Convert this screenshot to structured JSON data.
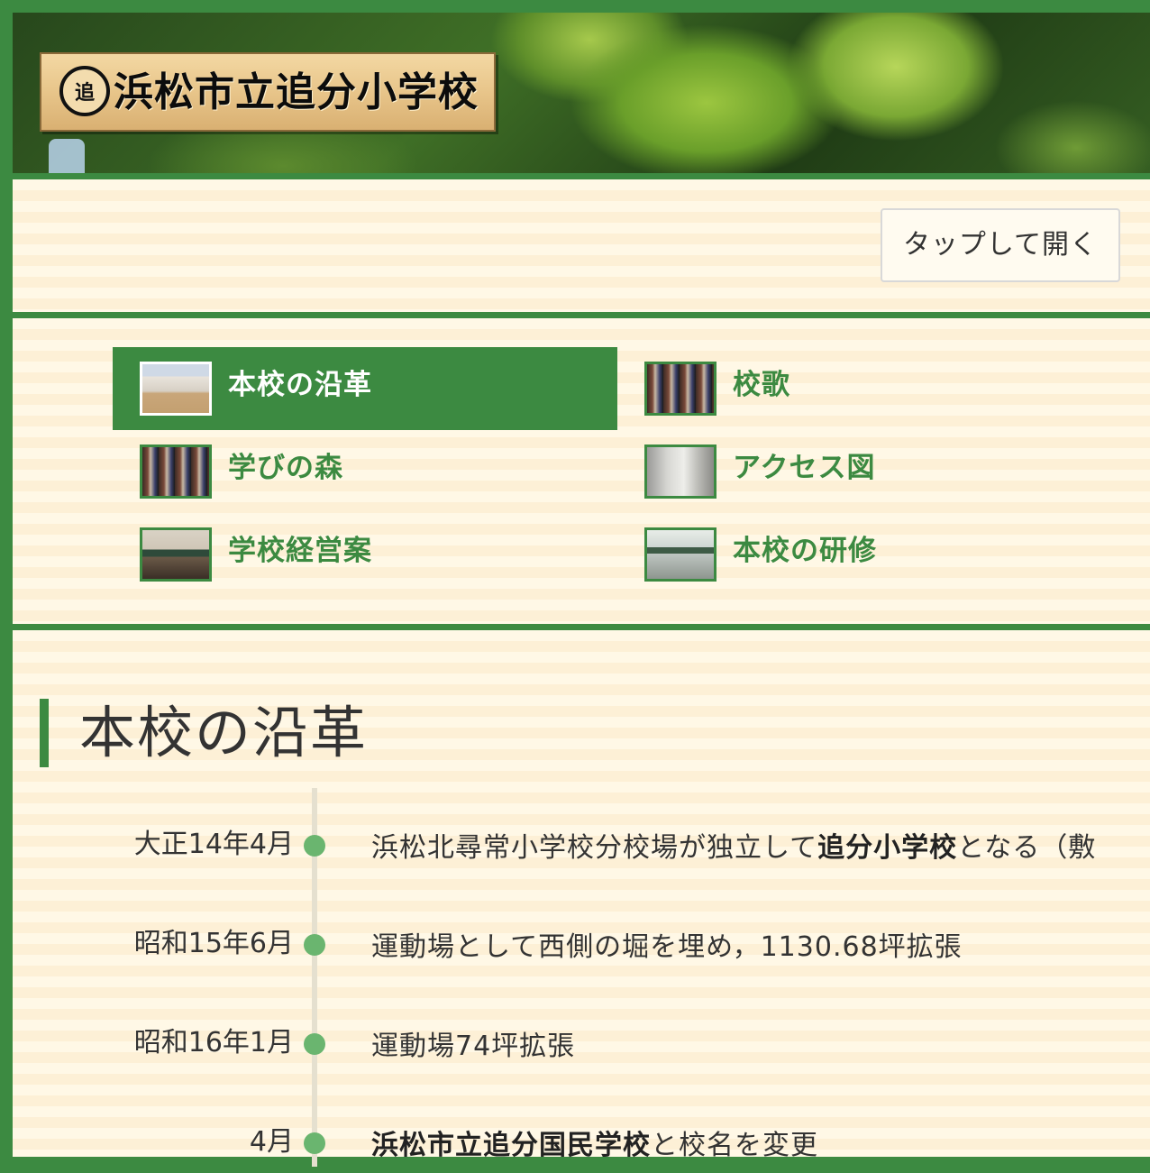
{
  "header": {
    "logo_mark": "追",
    "school_name": "浜松市立追分小学校"
  },
  "menu": {
    "open_label": "タップして開く"
  },
  "nav": {
    "items": [
      {
        "label": "本校の沿革",
        "icon": "school-building-thumbnail",
        "active": true
      },
      {
        "label": "校歌",
        "icon": "students-crowd-thumbnail"
      },
      {
        "label": "学びの森",
        "icon": "students-crowd-thumbnail"
      },
      {
        "label": "アクセス図",
        "icon": "principal-door-thumbnail"
      },
      {
        "label": "学校経営案",
        "icon": "classroom-lesson-thumbnail"
      },
      {
        "label": "本校の研修",
        "icon": "classroom-interior-thumbnail"
      }
    ]
  },
  "main": {
    "title": "本校の沿革",
    "timeline": [
      {
        "date": "大正14年4月",
        "text_before": "浜松北尋常小学校分校場が独立して",
        "text_bold": "追分小学校",
        "text_after": "となる（敷"
      },
      {
        "date": "昭和15年6月",
        "text_before": "運動場として西側の堀を埋め，1130.68坪拡張",
        "text_bold": "",
        "text_after": ""
      },
      {
        "date": "昭和16年1月",
        "text_before": "運動場74坪拡張",
        "text_bold": "",
        "text_after": ""
      },
      {
        "date": "4月",
        "text_before": "",
        "text_bold": "浜松市立追分国民学校",
        "text_after": "と校名を変更"
      }
    ]
  },
  "colors": {
    "accent": "#3c8a41",
    "dot": "#6ab56f",
    "panel_light": "#fff8e6",
    "panel_stripe": "#fdf0d6"
  }
}
